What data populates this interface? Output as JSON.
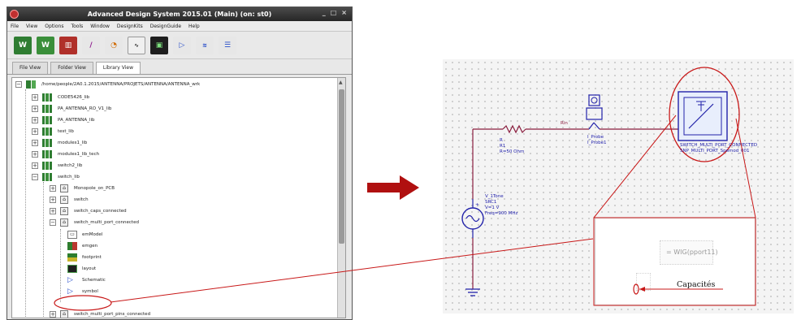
{
  "window": {
    "title": "Advanced Design System 2015.01 (Main) (on: st0)",
    "controls": [
      "_",
      "□",
      "×"
    ]
  },
  "menu": [
    "File",
    "View",
    "Options",
    "Tools",
    "Window",
    "DesignKits",
    "DesignGuide",
    "Help"
  ],
  "toolbar_icons": [
    "new-workspace-icon",
    "open-workspace-icon",
    "library-icon",
    "components-icon",
    "simulation-icon",
    "data-display-icon",
    "schematic-icon",
    "symbol-icon",
    "layout-icon",
    "emsetup-icon"
  ],
  "tabs": [
    {
      "label": "File View",
      "active": false
    },
    {
      "label": "Folder View",
      "active": false
    },
    {
      "label": "Library View",
      "active": true
    }
  ],
  "tree": {
    "root": "/home/people/2A0.1.2015/ANTENNA/PROJETS/ANTENNA/ANTENNA_wrk",
    "libraries": [
      {
        "name": "CODE5426_lib"
      },
      {
        "name": "PA_ANTENNA_RO_V1_lib"
      },
      {
        "name": "PA_ANTENNA_lib"
      },
      {
        "name": "test_lib"
      },
      {
        "name": "modules1_lib"
      },
      {
        "name": "modules1_lib_tech"
      },
      {
        "name": "switch2_lib"
      },
      {
        "name": "switch_lib",
        "expanded": true
      }
    ],
    "cells": [
      {
        "name": "Monopole_on_PCB"
      },
      {
        "name": "switch"
      },
      {
        "name": "switch_caps_connected"
      },
      {
        "name": "switch_multi_port_connected",
        "expanded": true
      }
    ],
    "views": [
      {
        "name": "emModel"
      },
      {
        "name": "emgen"
      },
      {
        "name": "footprint"
      },
      {
        "name": "layout"
      },
      {
        "name": "Schematic"
      },
      {
        "name": "symbol",
        "highlighted": true
      }
    ],
    "last_cell": "switch_multi_port_pins_connected"
  },
  "schematic": {
    "resistor": {
      "type": "R",
      "name": "R1",
      "value": "R=50 Ohm"
    },
    "wire_label": "Rin",
    "probe": {
      "type": "I_Probe",
      "name": "I_Probe1"
    },
    "component": {
      "name": "SWITCH_MULTI_PORT_CONNECTED",
      "label": "SNP_MULTI_PORT_Spemod_001"
    },
    "source": {
      "type": "V_1Tone",
      "name": "SRC1",
      "voltage": "V=1 V",
      "freq": "Freq=900 MHz"
    }
  },
  "zoom_view": {
    "expression": "= WIG(pport11)",
    "annotation": "Capacités"
  },
  "colors": {
    "annotation": "#c81818",
    "wire": "#8b1e3f",
    "schematic_blue": "#2222aa",
    "arrow": "#b01010"
  }
}
